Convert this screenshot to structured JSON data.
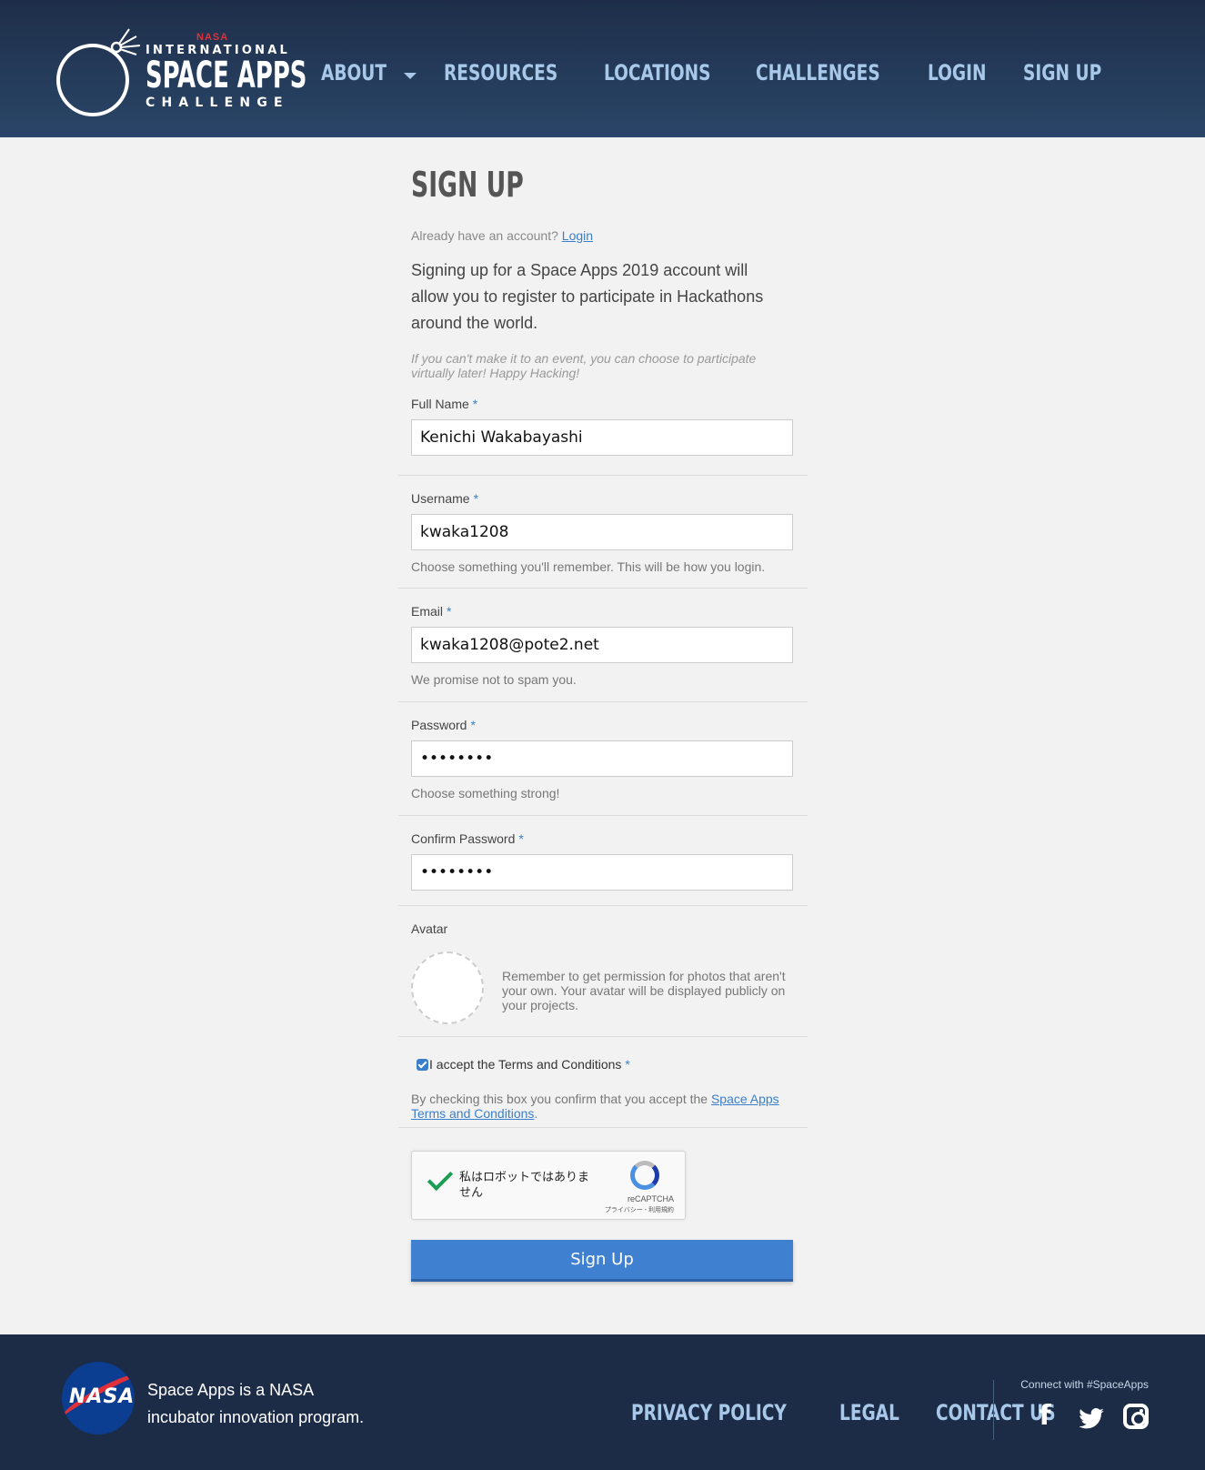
{
  "logo": {
    "nasa": "NASA",
    "line1": "INTERNATIONAL",
    "line2": "SPACE APPS",
    "line3": "CHALLENGE"
  },
  "nav": {
    "about": "ABOUT",
    "resources": "RESOURCES",
    "locations": "LOCATIONS",
    "challenges": "CHALLENGES",
    "login": "LOGIN",
    "signup": "SIGN UP"
  },
  "page": {
    "title": "SIGN UP",
    "already_text": "Already have an account?",
    "login_link": "Login",
    "intro": "Signing up for a Space Apps 2019 account will allow you to register to participate in Hackathons around the world.",
    "note": "If you can't make it to an event, you can choose to participate virtually later! Happy Hacking!"
  },
  "form": {
    "full_name": {
      "label": "Full Name",
      "required": "*",
      "value": "Kenichi Wakabayashi"
    },
    "username": {
      "label": "Username",
      "required": "*",
      "value": "kwaka1208",
      "help": "Choose something you'll remember. This will be how you login."
    },
    "email": {
      "label": "Email",
      "required": "*",
      "value": "kwaka1208@pote2.net",
      "help": "We promise not to spam you."
    },
    "password": {
      "label": "Password",
      "required": "*",
      "value": "••••••••",
      "help": "Choose something strong!"
    },
    "confirm_password": {
      "label": "Confirm Password",
      "required": "*",
      "value": "••••••••"
    },
    "avatar": {
      "label": "Avatar",
      "help": "Remember to get permission for photos that aren't your own. Your avatar will be displayed publicly on your projects."
    },
    "terms": {
      "label": "I accept the Terms and Conditions",
      "required": "*",
      "checked": true,
      "help_prefix": "By checking this box you confirm that you accept the",
      "help_link": "Space Apps Terms and Conditions",
      "help_suffix": "."
    },
    "captcha": {
      "text": "私はロボットではありません",
      "brand": "reCAPTCHA",
      "links": "プライバシー - 利用規約"
    },
    "submit": "Sign Up"
  },
  "footer": {
    "nasa_logo": "NASA",
    "tagline": "Space Apps is a NASA incubator innovation program.",
    "nav": {
      "privacy": "PRIVACY POLICY",
      "legal": "LEGAL",
      "contact": "CONTACT US"
    },
    "connect": "Connect with #SpaceApps",
    "social_icons": [
      "facebook-icon",
      "twitter-icon",
      "instagram-icon"
    ]
  },
  "colors": {
    "header_bg": "#1e2e49",
    "nav_link": "#a8c8ea",
    "accent": "#3a7fcc",
    "button": "#4080d0",
    "footer_bg": "#1c2c47",
    "nasa_red": "#e0313b"
  }
}
